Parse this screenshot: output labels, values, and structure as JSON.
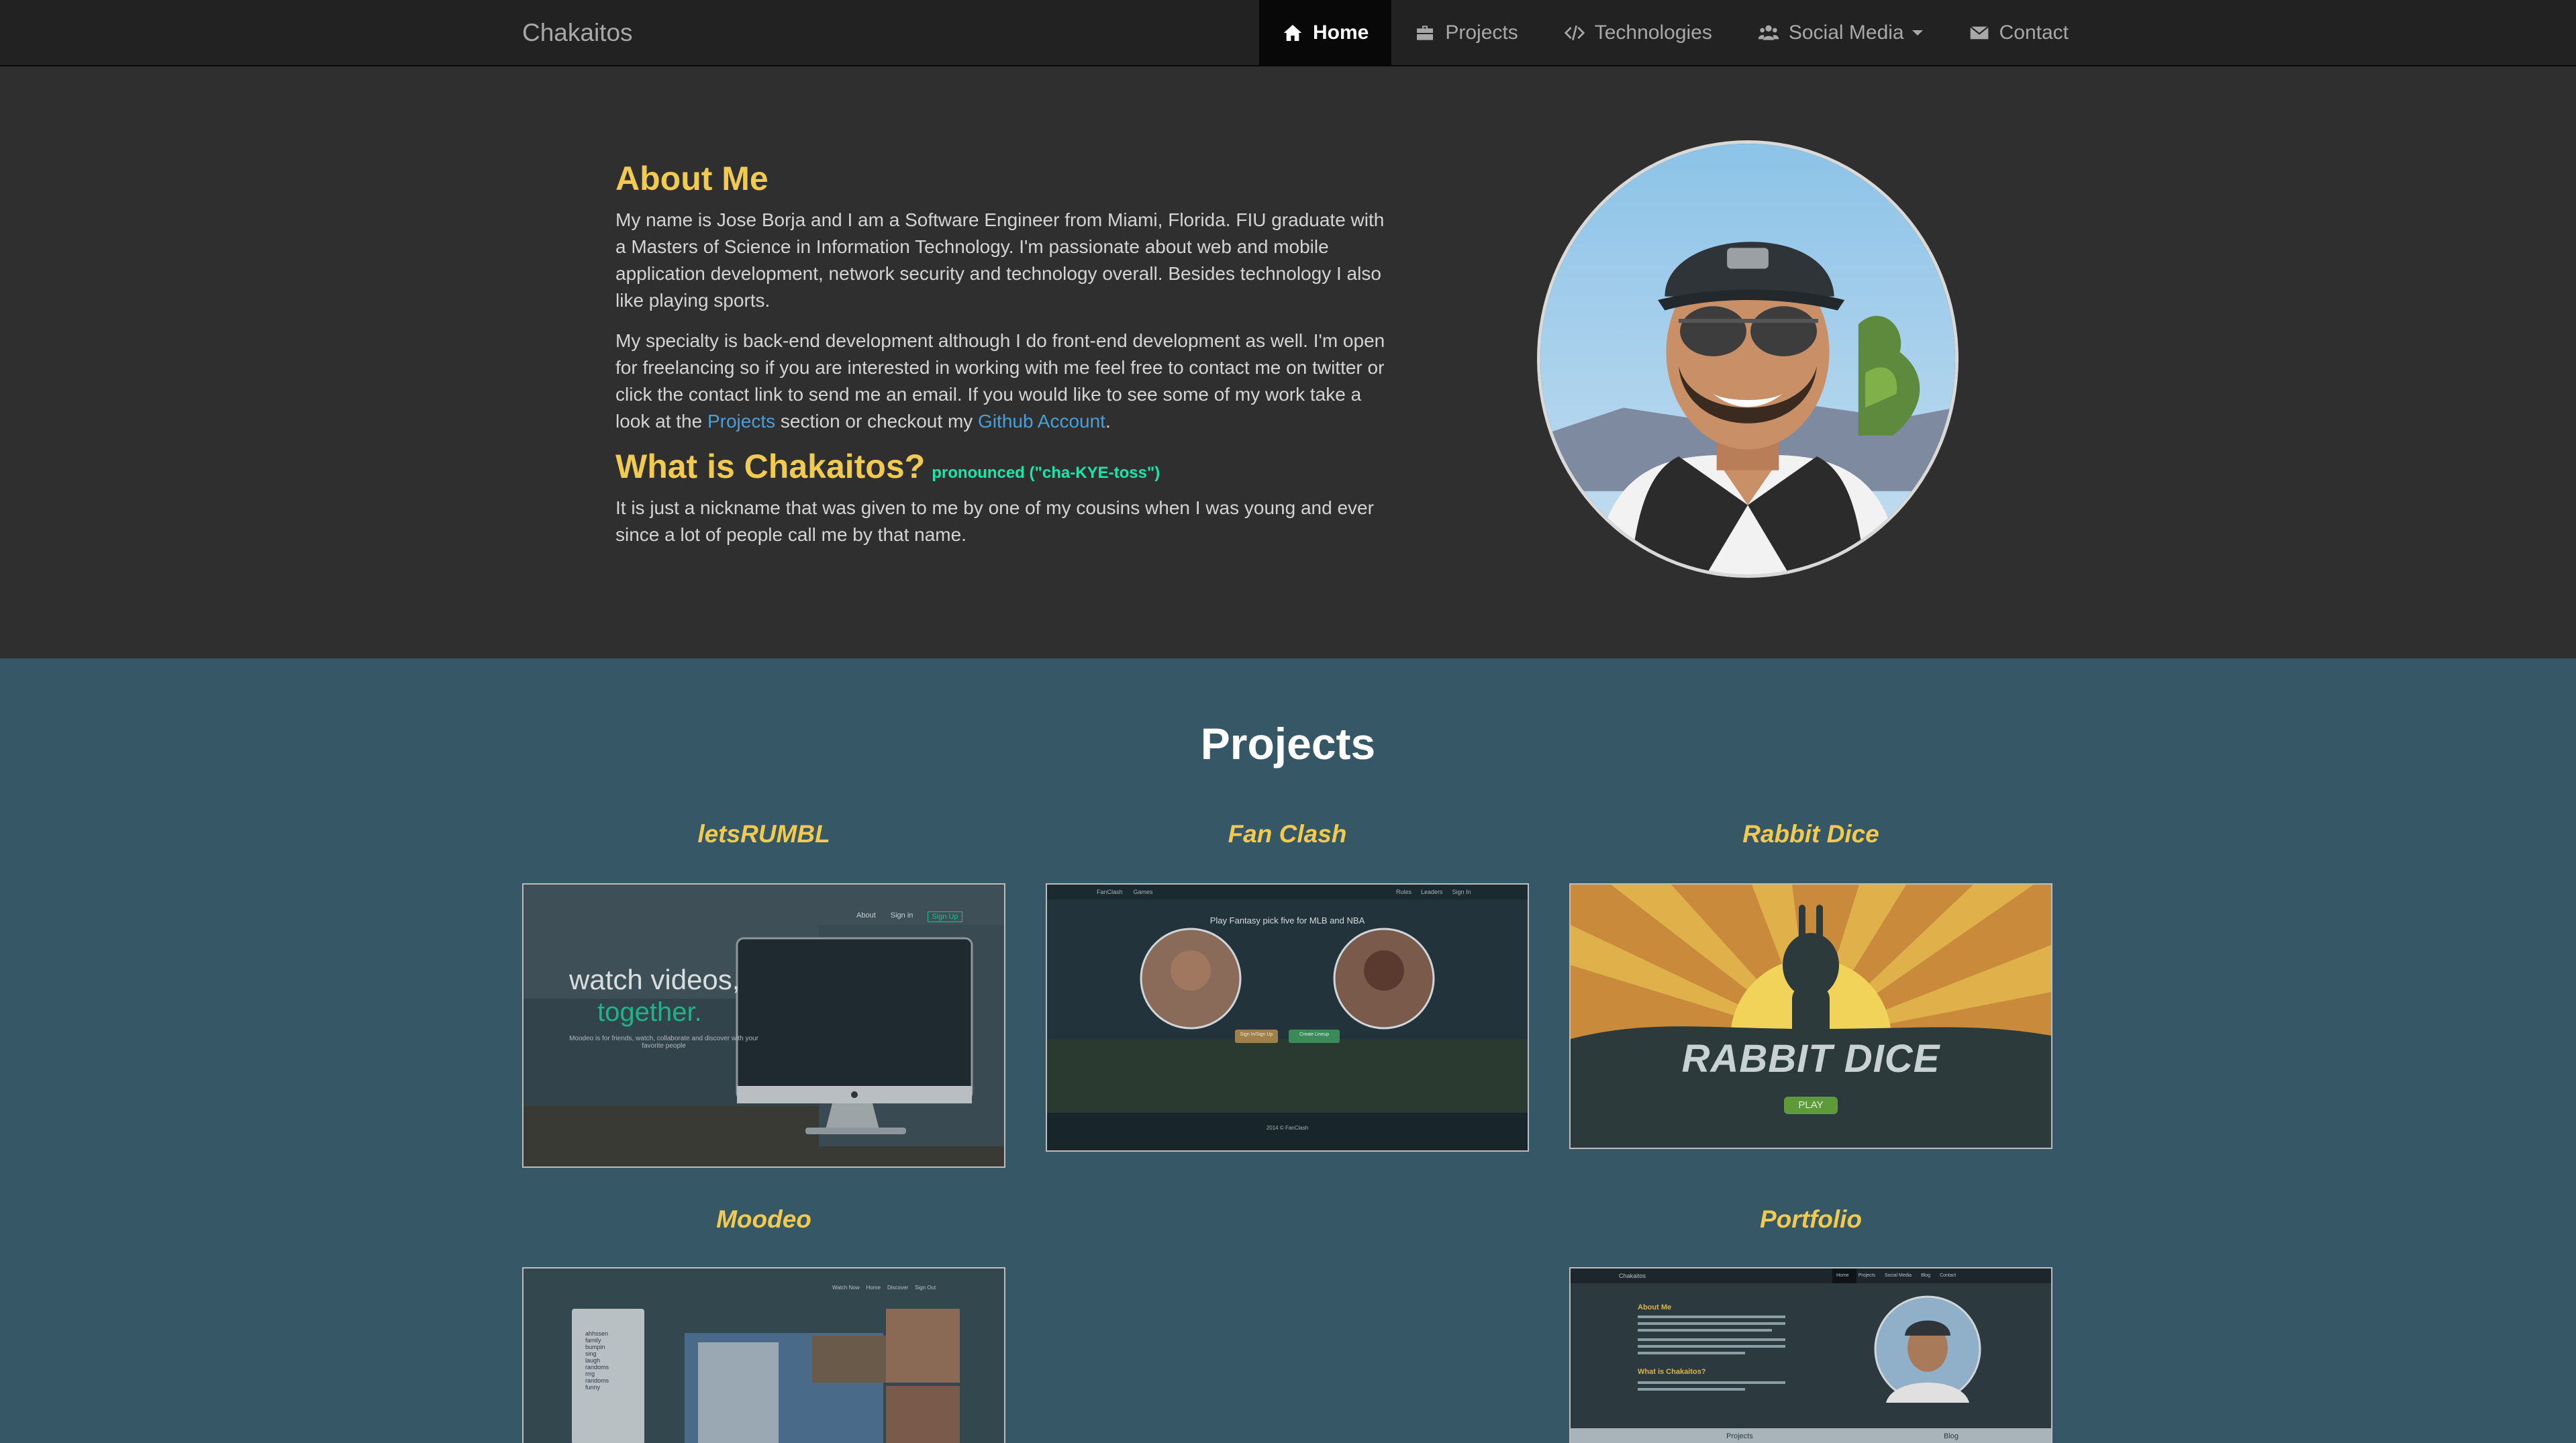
{
  "nav": {
    "brand": "Chakaitos",
    "items": [
      {
        "label": "Home",
        "icon": "home-icon",
        "active": true
      },
      {
        "label": "Projects",
        "icon": "briefcase-icon"
      },
      {
        "label": "Technologies",
        "icon": "code-icon"
      },
      {
        "label": "Social Media",
        "icon": "users-icon",
        "dropdown": true
      },
      {
        "label": "Contact",
        "icon": "envelope-icon"
      }
    ]
  },
  "about": {
    "heading": "About Me",
    "p1": "My name is Jose Borja and I am a Software Engineer from Miami, Florida. FIU graduate with a Masters of Science in Information Technology. I'm passionate about web and mobile application development, network security and technology overall. Besides technology I also like playing sports.",
    "p2_a": "My specialty is back-end development although I do front-end development as well. I'm open for freelancing so if you are interested in working with me feel free to contact me on twitter or click the contact link to send me an email. If you would like to see some of my work take a look at the ",
    "p2_link1": "Projects",
    "p2_b": " section or checkout my ",
    "p2_link2": "Github Account",
    "p2_c": ".",
    "heading2": "What is Chakaitos?",
    "pronunciation": "pronounced (\"cha-KYE-toss\")",
    "p3": "It is just a nickname that was given to me by one of my cousins when I was young and ever since a lot of people call me by that name."
  },
  "projects": {
    "title": "Projects",
    "items": [
      {
        "name": "letsRUMBL",
        "thumb_line1": "watch videos,",
        "thumb_line2": "together.",
        "thumb_sub": "Moodeo is for friends, watch, collaborate and discover with your favorite people",
        "thumb_nav": [
          "About",
          "Sign in",
          "Sign Up"
        ]
      },
      {
        "name": "Fan Clash",
        "thumb_headline": "Play Fantasy pick five for MLB and NBA",
        "thumb_nav": [
          "FanClash",
          "Games",
          "Rules",
          "Leaders",
          "Sign In"
        ],
        "thumb_btn1": "Sign In/Sign Up",
        "thumb_btn2": "Create Lineup",
        "thumb_footer": "2014 © FanClash"
      },
      {
        "name": "Rabbit Dice",
        "thumb_title": "RABBIT DICE",
        "thumb_btn": "PLAY"
      },
      {
        "name": "Moodeo",
        "thumb_nav": [
          "Watch Now",
          "Home",
          "Discover",
          "Sign Out"
        ],
        "thumb_list": [
          "ahhssen",
          "family",
          "bumpin",
          "sing",
          "laugh",
          "randoms",
          "rrrg",
          "randoms",
          "funny"
        ]
      },
      {
        "name": "Portfolio",
        "thumb_brand": "Chakaitos",
        "thumb_nav": [
          "Home",
          "Projects",
          "Social Media",
          "Blog",
          "Contact"
        ],
        "thumb_h1": "About Me",
        "thumb_h2": "What is Chakaitos?",
        "thumb_footer_links": [
          "Projects",
          "Blog"
        ]
      }
    ]
  },
  "colors": {
    "navbar": "#222222",
    "about_bg": "#2f2f2f",
    "projects_bg": "#355766",
    "accent_yellow": "#f1ca4f",
    "link_blue": "#4a9fd8",
    "pronunciation_green": "#19e6a8"
  }
}
